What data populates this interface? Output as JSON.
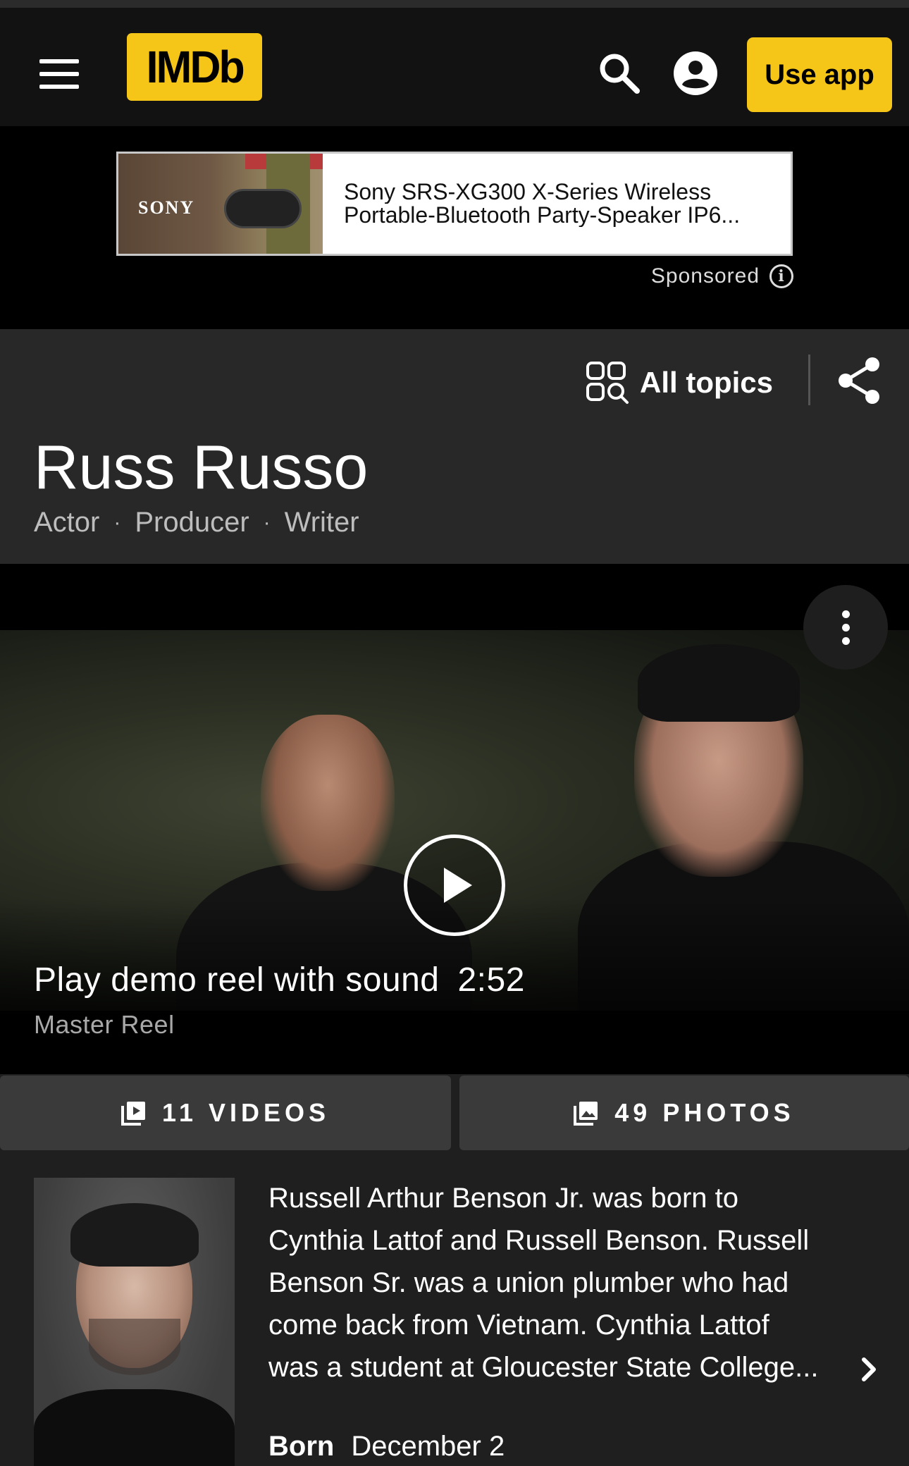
{
  "header": {
    "logo_text": "IMDb",
    "use_app_label": "Use app",
    "icons": {
      "menu": "hamburger-menu-icon",
      "search": "search-icon",
      "account": "account-circle-icon"
    },
    "accent_color": "#f5c518"
  },
  "ad": {
    "brand": "SONY",
    "text_line1": "Sony SRS-XG300 X-Series Wireless",
    "text_line2": "Portable-Bluetooth Party-Speaker IP6...",
    "sponsored_label": "Sponsored",
    "info_glyph": "i"
  },
  "title_section": {
    "all_topics_label": "All topics",
    "name": "Russ Russo",
    "roles": [
      "Actor",
      "Producer",
      "Writer"
    ],
    "separator": "·"
  },
  "video": {
    "caption": "Play demo reel with sound",
    "duration": "2:52",
    "subtitle": "Master Reel"
  },
  "media": {
    "videos_label": "11 VIDEOS",
    "photos_label": "49 PHOTOS"
  },
  "bio": {
    "lines": [
      "Russell Arthur Benson Jr. was born to",
      "Cynthia Lattof and Russell Benson. Russell",
      "Benson Sr. was a union plumber who had",
      "come back from Vietnam. Cynthia Lattof",
      "was a student at Gloucester State College..."
    ],
    "born_label": "Born",
    "born_value": "December 2"
  }
}
